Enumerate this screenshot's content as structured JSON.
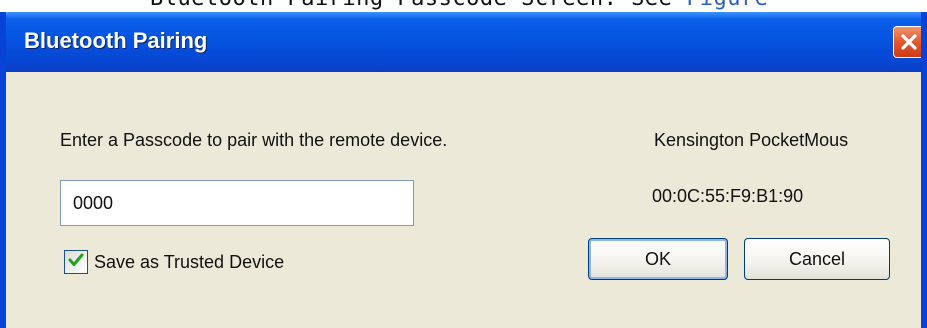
{
  "document": {
    "caption_text": "Bluetooth Pairing Passcode Screen. See ",
    "caption_link": "Figure"
  },
  "window": {
    "title": "Bluetooth Pairing",
    "close_icon": "close-icon",
    "titlebar_color": "#0553e1",
    "close_color": "#e2592e"
  },
  "dialog": {
    "prompt": "Enter a Passcode to pair with the remote device.",
    "passcode_value": "0000",
    "passcode_placeholder": "",
    "trusted_checked": true,
    "trusted_label": "Save as Trusted Device",
    "device_name": "Kensington PocketMous",
    "device_address": "00:0C:55:F9:B1:90",
    "ok_label": "OK",
    "cancel_label": "Cancel",
    "check_color": "#21a121"
  }
}
